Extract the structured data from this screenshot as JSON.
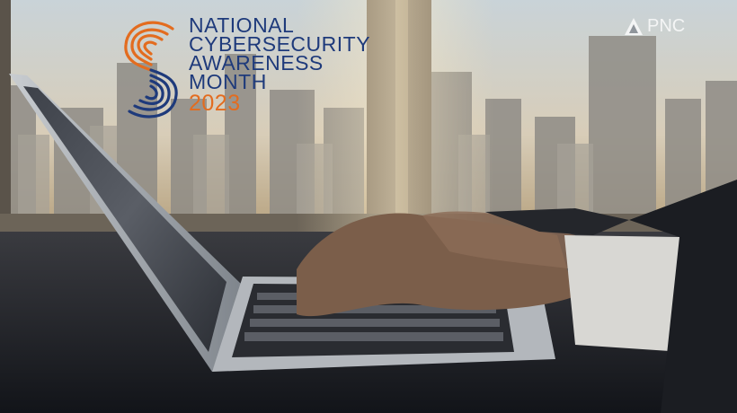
{
  "logo": {
    "line1": "NATIONAL",
    "line2": "CYBERSECURITY",
    "line3": "AWARENESS",
    "line4": "MONTH",
    "year": "2023",
    "mark_icon": "fingerprint-s-icon"
  },
  "brand": {
    "label": "PNC",
    "icon": "pnc-triangle-icon"
  },
  "colors": {
    "logo_blue": "#1e3a7b",
    "logo_orange": "#e36c1f"
  }
}
